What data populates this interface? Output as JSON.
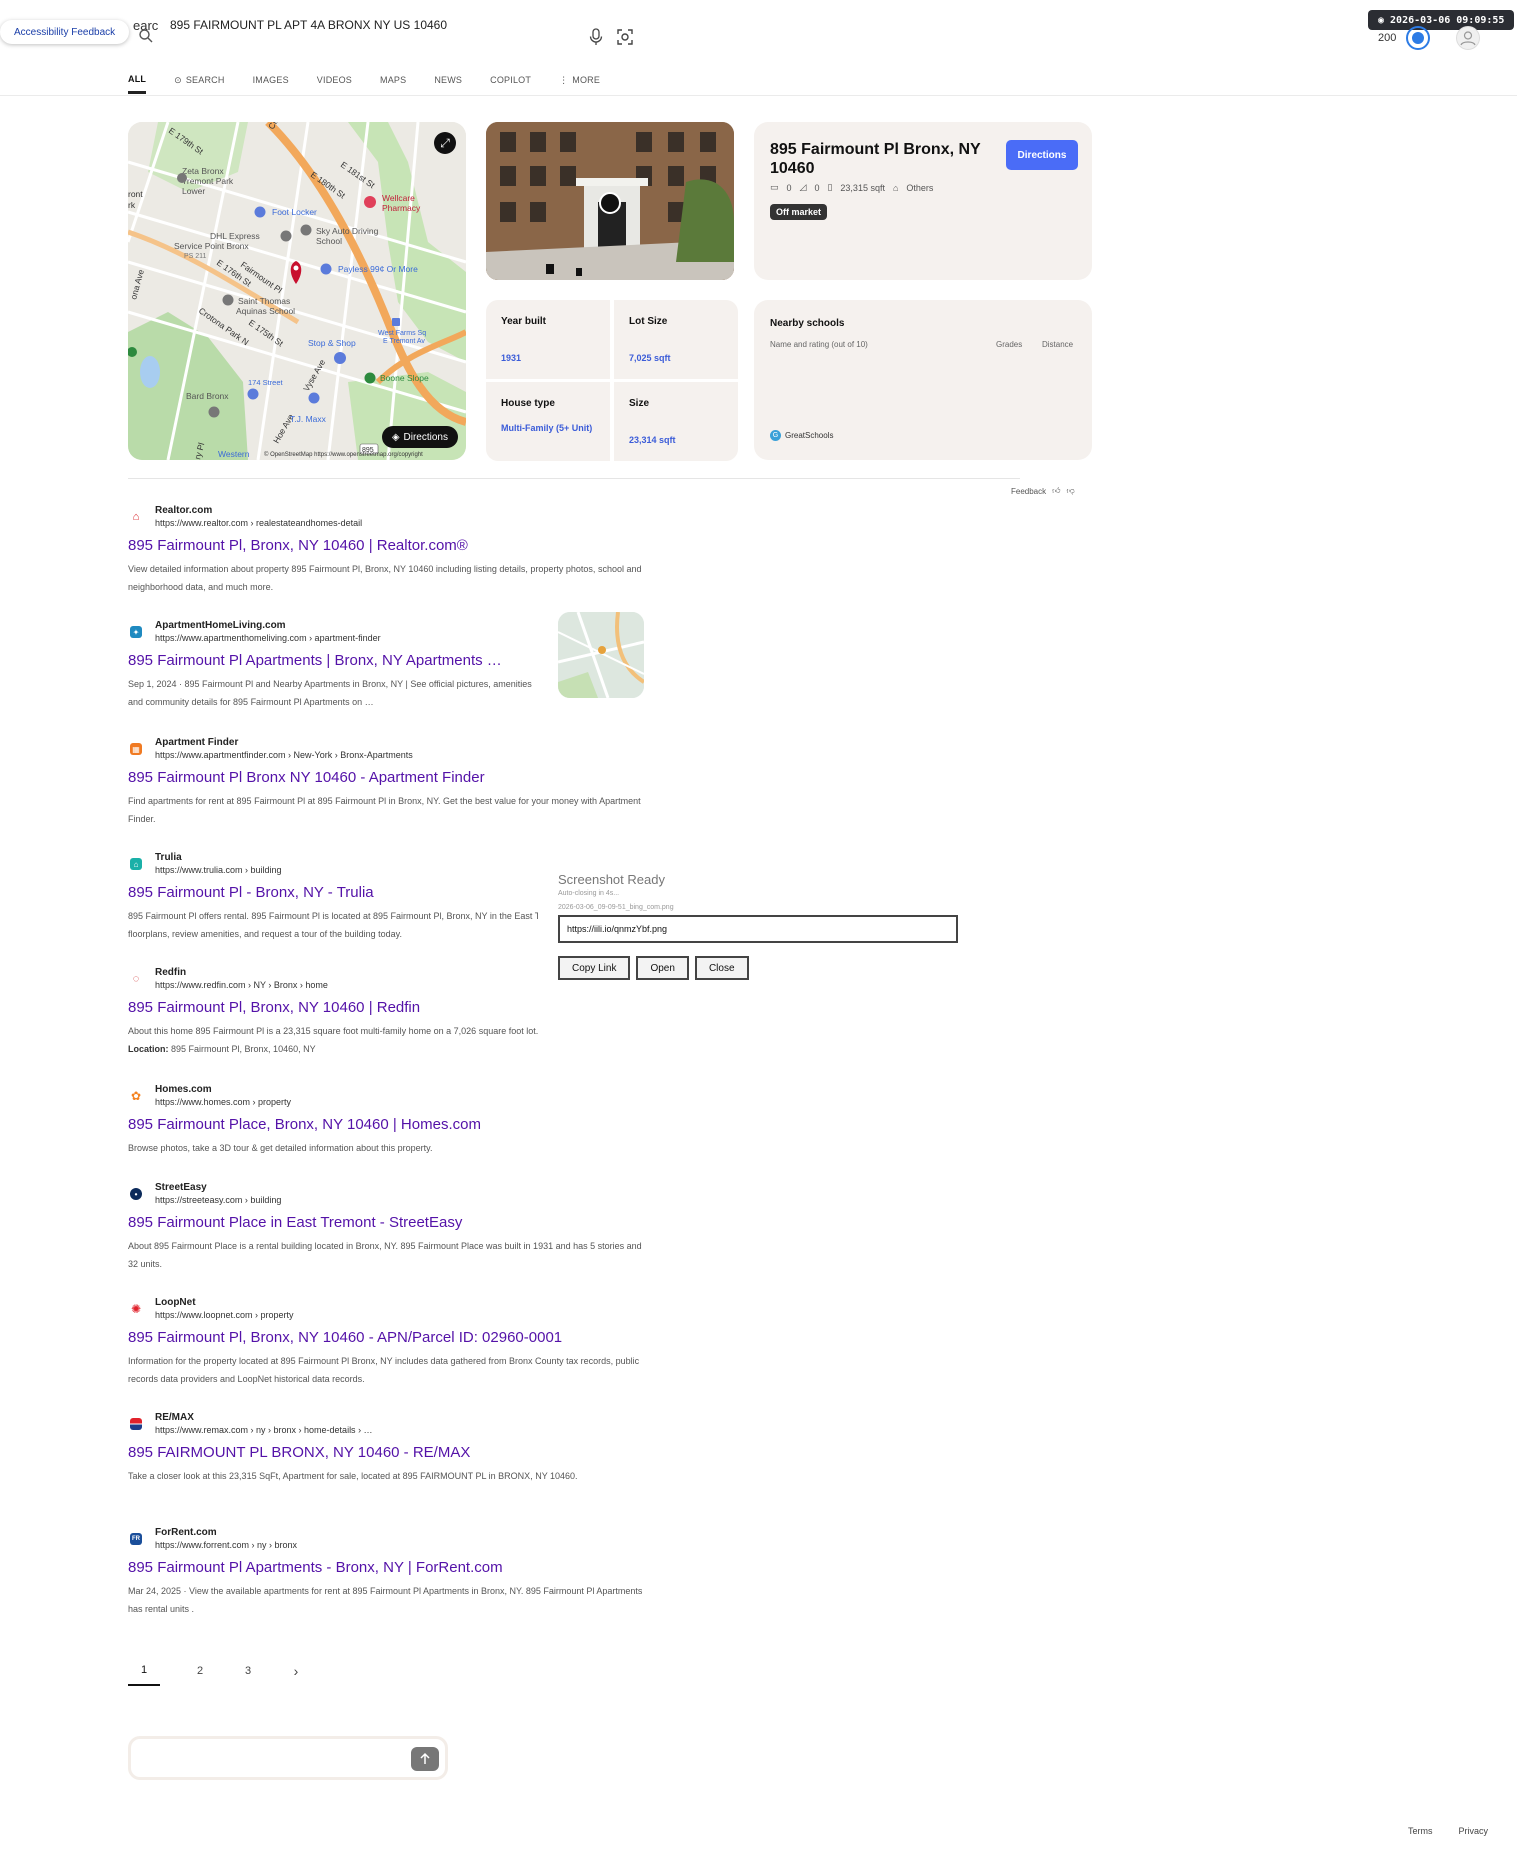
{
  "header": {
    "accessibility_feedback": "Accessibility Feedback",
    "search_prefix": "earc",
    "search_query": "895 FAIRMOUNT PL APT 4A BRONX NY US 10460",
    "timestamp": "2026-03-06 09:09:55",
    "reward_count": "200"
  },
  "nav": {
    "tabs": [
      {
        "label": "ALL",
        "icon": ""
      },
      {
        "label": "SEARCH",
        "icon": "copilot-search-icon"
      },
      {
        "label": "IMAGES",
        "icon": ""
      },
      {
        "label": "VIDEOS",
        "icon": ""
      },
      {
        "label": "MAPS",
        "icon": ""
      },
      {
        "label": "NEWS",
        "icon": ""
      },
      {
        "label": "COPILOT",
        "icon": ""
      },
      {
        "label": "MORE",
        "icon": "kebab-icon"
      }
    ]
  },
  "map": {
    "labels": {
      "e179": "E 179th St",
      "e181": "E 181st St",
      "e180": "E 180th St",
      "zeta": "Zeta Bronx",
      "zeta2": "Tremont Park",
      "zeta3": "Lower",
      "wellcare": "Wellcare",
      "wellcare2": "Pharmacy",
      "footlocker": "Foot Locker",
      "dhl": "DHL Express",
      "dhl2": "Service Point Bronx",
      "ps211": "PS 211",
      "sky": "Sky Auto Driving",
      "sky2": "School",
      "payless": "Payless 99¢ Or More",
      "fairmount": "Fairmount Pl",
      "e176": "E 176th St",
      "st_thomas": "Saint Thomas",
      "st_thomas2": "Aquinas School",
      "crotona": "Crotona Park N",
      "e175": "E 175th St",
      "stop_shop": "Stop & Shop",
      "west_farms": "West Farms Sq",
      "west_farms2": "E Tremont Av",
      "boone": "Boone Slope",
      "st174": "174 Street",
      "bard": "Bard Bronx",
      "vyse": "Vyse Ave",
      "hoe": "Hoe Ave",
      "tjmaxx": "T.J. Maxx",
      "western": "Western",
      "ront": "ront",
      "rk": "rk",
      "ona_ave": "ona Ave",
      "ry_pl": "ry Pl",
      "cli": "Cli"
    },
    "directions_label": "Directions",
    "attribution": "© OpenStreetMap https://www.openstreetmap.org/copyright",
    "route_badge": "895"
  },
  "property": {
    "title": "895 Fairmount Pl Bronx, NY 10460",
    "directions_button": "Directions",
    "beds": "0",
    "baths": "0",
    "sqft": "23,315 sqft",
    "type": "Others",
    "status_badge": "Off market"
  },
  "facts": [
    {
      "label": "Year built",
      "value": "1931"
    },
    {
      "label": "Lot Size",
      "value": "7,025 sqft"
    },
    {
      "label": "House type",
      "value": "Multi-Family (5+ Unit)"
    },
    {
      "label": "Size",
      "value": "23,314 sqft"
    }
  ],
  "schools": {
    "title": "Nearby schools",
    "subtitle": "Name and rating (out of 10)",
    "col_grades": "Grades",
    "col_distance": "Distance",
    "source": "GreatSchools",
    "source_badge": "G"
  },
  "feedback": {
    "label": "Feedback"
  },
  "results": [
    {
      "site": "Realtor.com",
      "url": "https://www.realtor.com › realestateandhomes-detail",
      "title": "895 Fairmount Pl, Bronx, NY 10460 | Realtor.com®",
      "snippet": "View detailed information about property 895 Fairmount Pl, Bronx, NY 10460 including listing details, property photos, school and neighborhood data, and much more.",
      "favicon_color": "#d92228",
      "favicon": "house-icon"
    },
    {
      "site": "ApartmentHomeLiving.com",
      "url": "https://www.apartmenthomeliving.com › apartment-finder",
      "title": "895 Fairmount Pl Apartments | Bronx, NY Apartments …",
      "snippet": "Sep 1, 2024 · 895 Fairmount Pl and Nearby Apartments in Bronx, NY | See official pictures, amenities and community details for 895 Fairmount Pl Apartments on …",
      "favicon_color": "#1f8ac0",
      "favicon": "leaf-icon"
    },
    {
      "site": "Apartment Finder",
      "url": "https://www.apartmentfinder.com › New-York › Bronx-Apartments",
      "title": "895 Fairmount Pl Bronx NY 10460 - Apartment Finder",
      "snippet": "Find apartments for rent at 895 Fairmount Pl at 895 Fairmount Pl in Bronx, NY. Get the best value for your money with Apartment Finder.",
      "favicon_color": "#f07a22",
      "favicon": "building-icon"
    },
    {
      "site": "Trulia",
      "url": "https://www.trulia.com › building",
      "title": "895 Fairmount Pl - Bronx, NY - Trulia",
      "snippet": "895 Fairmount Pl offers rental. 895 Fairmount Pl is located at 895 Fairmount Pl, Bronx, NY in the East Tremont neighborhood. See floorplans, review amenities, and request a tour of the building today.",
      "favicon_color": "#1ab0a8",
      "favicon": "house-icon"
    },
    {
      "site": "Redfin",
      "url": "https://www.redfin.com › NY › Bronx › home",
      "title": "895 Fairmount Pl, Bronx, NY 10460 | Redfin",
      "snippet": "About this home 895 Fairmount Pl is a 23,315 square foot multi-family home on a 7,026 square foot lot.",
      "snippet_label": "Location:",
      "snippet_extra": "895 Fairmount Pl, Bronx, 10460, NY",
      "favicon_color": "#c82021",
      "favicon": "ring-icon"
    },
    {
      "site": "Homes.com",
      "url": "https://www.homes.com › property",
      "title": "895 Fairmount Place, Bronx, NY 10460 | Homes.com",
      "snippet": "Browse photos, take a 3D tour & get detailed information about this property.",
      "favicon_color": "#f5821f",
      "favicon": "flower-icon"
    },
    {
      "site": "StreetEasy",
      "url": "https://streeteasy.com › building",
      "title": "895 Fairmount Place in East Tremont - StreetEasy",
      "snippet": "About 895 Fairmount Place is a rental building located in Bronx, NY. 895 Fairmount Place was built in 1931 and has 5 stories and 32 units.",
      "favicon_color": "#0b2a5b",
      "favicon": "pin-icon"
    },
    {
      "site": "LoopNet",
      "url": "https://www.loopnet.com › property",
      "title": "895 Fairmount Pl, Bronx, NY 10460 - APN/Parcel ID: 02960-0001",
      "snippet": "Information for the property located at 895 Fairmount Pl Bronx, NY includes data gathered from Bronx County tax records, public records data providers and LoopNet historical data records.",
      "favicon_color": "#e0202a",
      "favicon": "loop-icon"
    },
    {
      "site": "RE/MAX",
      "url": "https://www.remax.com › ny › bronx › home-details › …",
      "title": "895 FAIRMOUNT PL BRONX, NY 10460 - RE/MAX",
      "snippet": "Take a closer look at this 23,315 SqFt, Apartment for sale, located at 895 FAIRMOUNT PL in BRONX, NY 10460.",
      "favicon_color": "#1d3c8a",
      "favicon": "balloon-icon"
    },
    {
      "site": "ForRent.com",
      "url": "https://www.forrent.com › ny › bronx",
      "title": "895 Fairmount Pl Apartments - Bronx, NY | ForRent.com",
      "snippet": "Mar 24, 2025 · View the available apartments for rent at 895 Fairmount Pl Apartments in Bronx, NY. 895 Fairmount Pl Apartments has rental units .",
      "favicon_color": "#1a4e9a",
      "favicon": "fr-icon",
      "favicon_text": "FR"
    }
  ],
  "popup": {
    "title": "Screenshot Ready",
    "subtitle": "Auto-closing in 4s...",
    "filename": "2026-03-06_09-09-51_bing_com.png",
    "link": "https://iili.io/qnmzYbf.png",
    "copy_label": "Copy Link",
    "open_label": "Open",
    "close_label": "Close"
  },
  "pagination": {
    "pages": [
      "1",
      "2",
      "3"
    ],
    "current": "1"
  },
  "footer": {
    "terms": "Terms",
    "privacy": "Privacy"
  }
}
